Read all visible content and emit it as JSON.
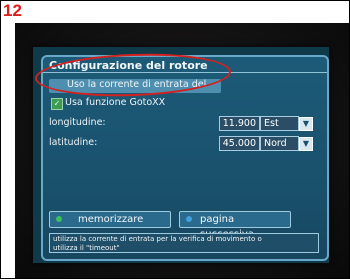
{
  "step": {
    "number": "12"
  },
  "osd": {
    "title": "Configurazione del rotore",
    "use_input_current_label": "Uso la corrente di entrata del",
    "goto_label": "Usa funzione GotoXX",
    "goto_checked": true,
    "longitude_label": "longitudine:",
    "longitude_value": "11.900",
    "longitude_dir": "Est",
    "latitude_label": "latitudine:",
    "latitude_value": "45.000",
    "latitude_dir": "Nord",
    "save_button": "memorizzare",
    "next_button": "pagina successiva",
    "help_line1": "utilizza la corrente di entrata per la verifica di movimento o",
    "help_line2": "utilizza il \"timeout\""
  },
  "colors": {
    "annotation": "#d52020",
    "step_number": "#e01b1b",
    "save_dot": "#3fbf5a",
    "next_dot": "#3fa0e0"
  }
}
